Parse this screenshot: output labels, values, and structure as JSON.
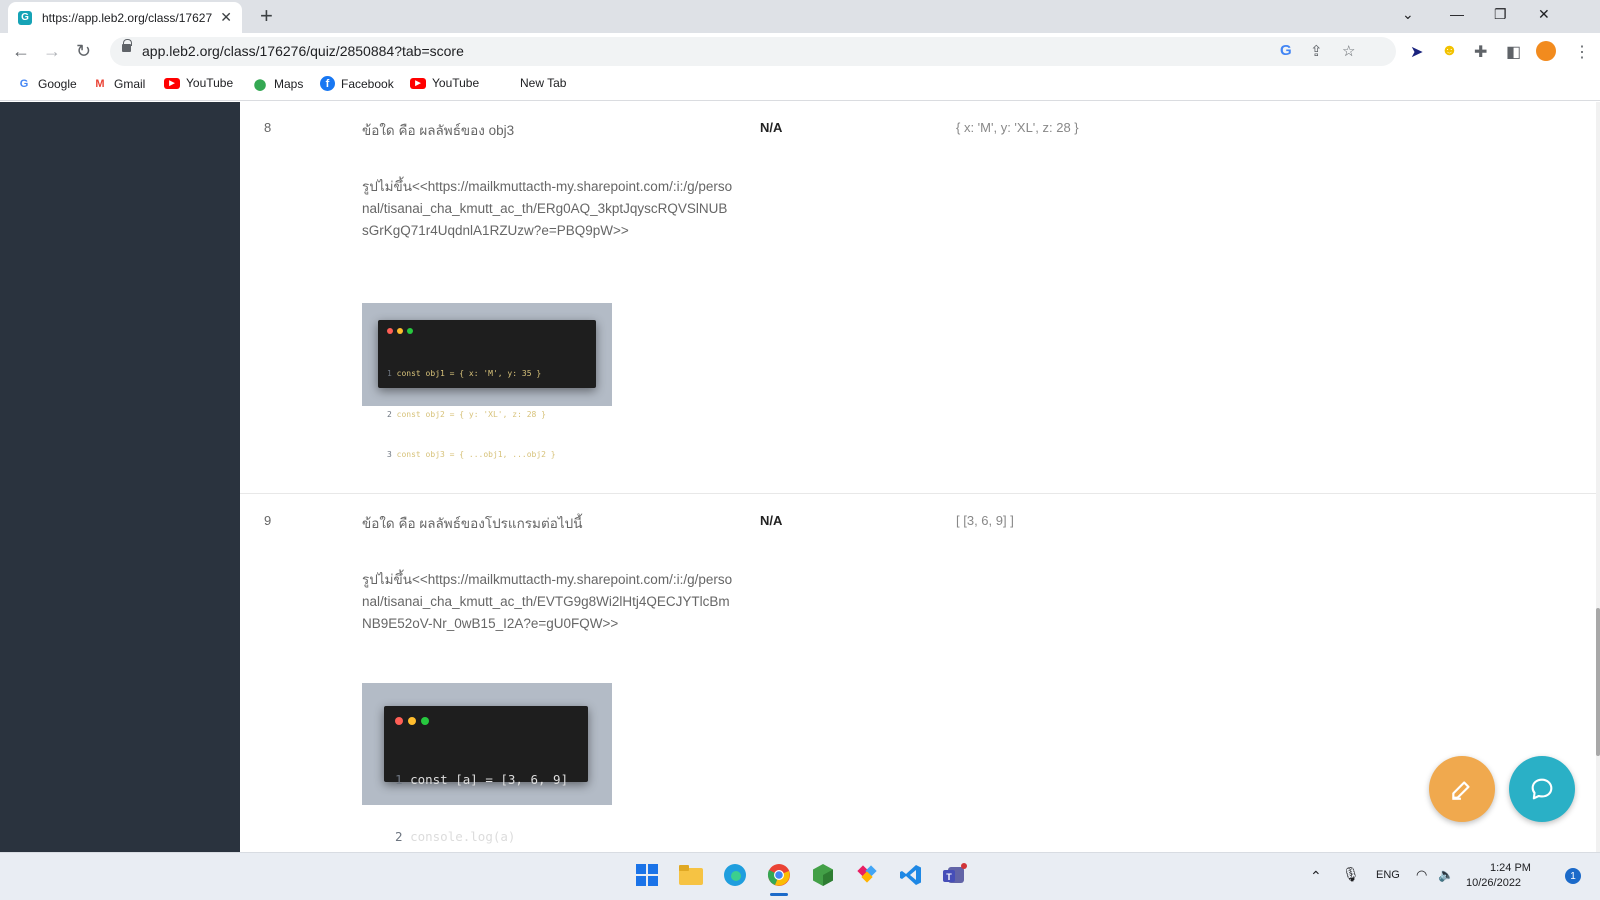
{
  "browser": {
    "tab_title": "https://app.leb2.org/class/17627",
    "tab_favicon_letter": "G",
    "url": "app.leb2.org/class/176276/quiz/2850884?tab=score",
    "bookmarks": [
      {
        "label": "Google",
        "icon": "google-icon"
      },
      {
        "label": "Gmail",
        "icon": "gmail-icon"
      },
      {
        "label": "YouTube",
        "icon": "youtube-icon"
      },
      {
        "label": "Maps",
        "icon": "maps-icon"
      },
      {
        "label": "Facebook",
        "icon": "facebook-icon"
      },
      {
        "label": "YouTube",
        "icon": "youtube-icon"
      },
      {
        "label": "New Tab",
        "icon": "none"
      }
    ]
  },
  "questions": [
    {
      "number": "8",
      "text": "ข้อใด คือ ผลลัพธ์ของ obj3",
      "image_link": "รูปไม่ขึ้น<<https://mailkmuttacth-my.sharepoint.com/:i:/g/personal/tisanai_cha_kmutt_ac_th/ERg0AQ_3kptJqyscRQVSlNUBsGrKgQ71r4UqdnlA1RZUzw?e=PBQ9pW>>",
      "score": "N/A",
      "answer": "{ x: 'M', y: 'XL', z: 28 }",
      "code": [
        {
          "ln": "1",
          "text": "const obj1 = { x: 'M', y: 35 }"
        },
        {
          "ln": "2",
          "text": "const obj2 = { y: 'XL', z: 28 }"
        },
        {
          "ln": "3",
          "text": "const obj3 = { ...obj1, ...obj2 }"
        }
      ]
    },
    {
      "number": "9",
      "text": "ข้อใด คือ ผลลัพธ์ของโปรแกรมต่อไปนี้",
      "image_link": "รูปไม่ขึ้น<<https://mailkmuttacth-my.sharepoint.com/:i:/g/personal/tisanai_cha_kmutt_ac_th/EVTG9g8Wi2lHtj4QECJYTlcBmNB9E52oV-Nr_0wB15_I2A?e=gU0FQW>>",
      "score": "N/A",
      "answer": "[ [3, 6, 9] ]",
      "code": [
        {
          "ln": "1",
          "text": "const [a] = [3, 6, 9]"
        },
        {
          "ln": "2",
          "text": "console.log(a)"
        }
      ]
    }
  ],
  "taskbar": {
    "language": "ENG",
    "time": "1:24 PM",
    "date": "10/26/2022",
    "notification_count": "1"
  }
}
